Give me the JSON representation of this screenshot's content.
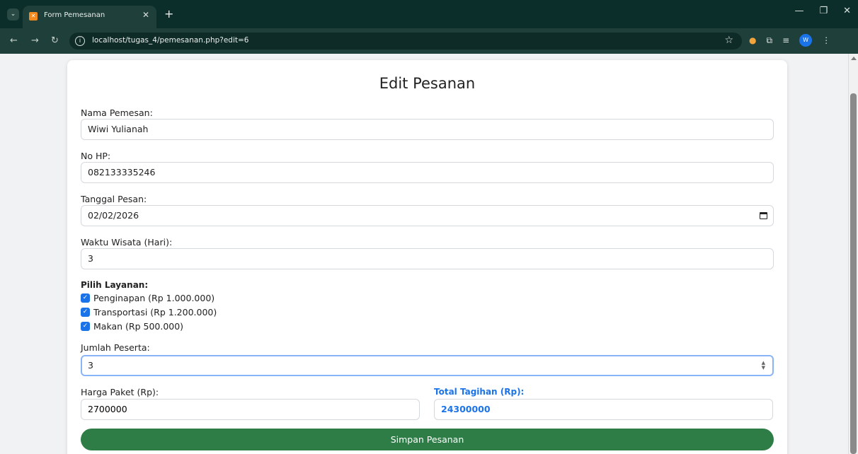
{
  "browser": {
    "tab_title": "Form Pemesanan",
    "url": "localhost/tugas_4/pemesanan.php?edit=6",
    "profile_initial": "W"
  },
  "form": {
    "title": "Edit Pesanan",
    "nama_label": "Nama Pemesan:",
    "nama_value": "Wiwi Yulianah",
    "hp_label": "No HP:",
    "hp_value": "082133335246",
    "tanggal_label": "Tanggal Pesan:",
    "tanggal_value": "02/02/2026",
    "waktu_label": "Waktu Wisata (Hari):",
    "waktu_value": "3",
    "layanan_label": "Pilih Layanan:",
    "layanan": [
      {
        "label": "Penginapan (Rp 1.000.000)",
        "checked": true
      },
      {
        "label": "Transportasi (Rp 1.200.000)",
        "checked": true
      },
      {
        "label": "Makan (Rp 500.000)",
        "checked": true
      }
    ],
    "peserta_label": "Jumlah Peserta:",
    "peserta_value": "3",
    "harga_label": "Harga Paket (Rp):",
    "harga_value": "2700000",
    "total_label": "Total Tagihan (Rp):",
    "total_value": "24300000",
    "submit_label": "Simpan Pesanan"
  },
  "colors": {
    "accent": "#1a73e8",
    "submit": "#2e7d46",
    "chrome": "#1f3f3a"
  }
}
